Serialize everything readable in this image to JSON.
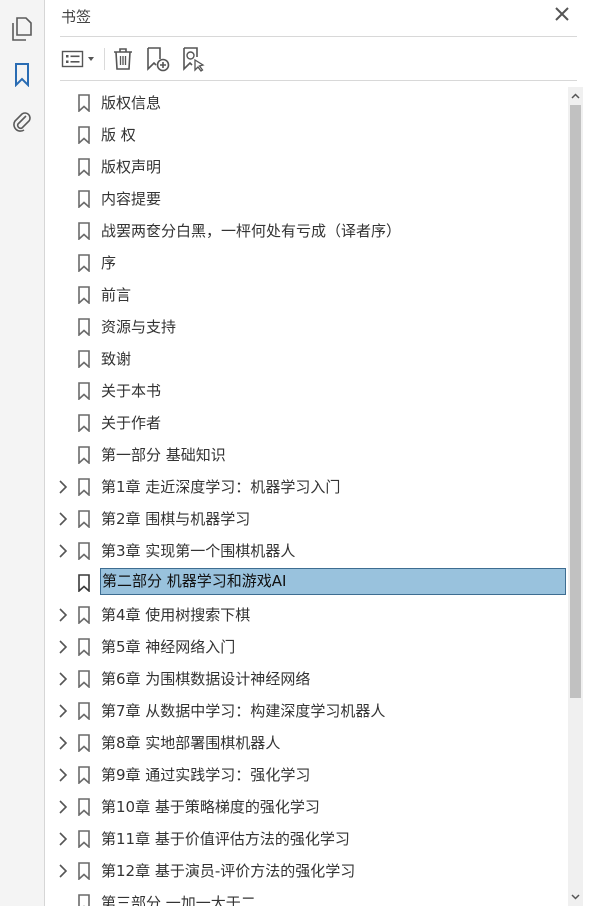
{
  "rail": {
    "items": [
      {
        "icon": "pages-icon"
      },
      {
        "icon": "bookmark-icon",
        "active": true
      },
      {
        "icon": "attachment-icon"
      }
    ]
  },
  "panel": {
    "title": "书签",
    "close_icon": "close-icon",
    "toolbar": [
      {
        "icon": "options-menu-icon"
      },
      {
        "icon": "delete-icon"
      },
      {
        "icon": "new-bookmark-icon"
      },
      {
        "icon": "bookmark-search-icon"
      }
    ]
  },
  "bookmarks": [
    {
      "label": "版权信息",
      "expandable": false
    },
    {
      "label": "版 权",
      "expandable": false
    },
    {
      "label": "版权声明",
      "expandable": false
    },
    {
      "label": "内容提要",
      "expandable": false
    },
    {
      "label": "战罢两奁分白黑，一枰何处有亏成（译者序）",
      "expandable": false
    },
    {
      "label": "序",
      "expandable": false
    },
    {
      "label": "前言",
      "expandable": false
    },
    {
      "label": "资源与支持",
      "expandable": false
    },
    {
      "label": "致谢",
      "expandable": false
    },
    {
      "label": "关于本书",
      "expandable": false
    },
    {
      "label": "关于作者",
      "expandable": false
    },
    {
      "label": "第一部分 基础知识",
      "expandable": false
    },
    {
      "label": "第1章 走近深度学习：机器学习入门",
      "expandable": true
    },
    {
      "label": "第2章 围棋与机器学习",
      "expandable": true
    },
    {
      "label": "第3章 实现第一个围棋机器人",
      "expandable": true
    },
    {
      "label": "第二部分 机器学习和游戏AI",
      "expandable": false,
      "selected": true
    },
    {
      "label": "第4章 使用树搜索下棋",
      "expandable": true
    },
    {
      "label": "第5章 神经网络入门",
      "expandable": true
    },
    {
      "label": "第6章 为围棋数据设计神经网络",
      "expandable": true
    },
    {
      "label": "第7章 从数据中学习：构建深度学习机器人",
      "expandable": true
    },
    {
      "label": "第8章 实地部署围棋机器人",
      "expandable": true
    },
    {
      "label": "第9章 通过实践学习：强化学习",
      "expandable": true
    },
    {
      "label": "第10章 基于策略梯度的强化学习",
      "expandable": true
    },
    {
      "label": "第11章 基于价值评估方法的强化学习",
      "expandable": true
    },
    {
      "label": "第12章 基于演员-评价方法的强化学习",
      "expandable": true
    },
    {
      "label": "第三部分 一加一大于二",
      "expandable": false
    }
  ],
  "colors": {
    "selected_bg": "#99c2dd",
    "selected_border": "#3e6d91",
    "active_icon": "#2a6cb3"
  }
}
